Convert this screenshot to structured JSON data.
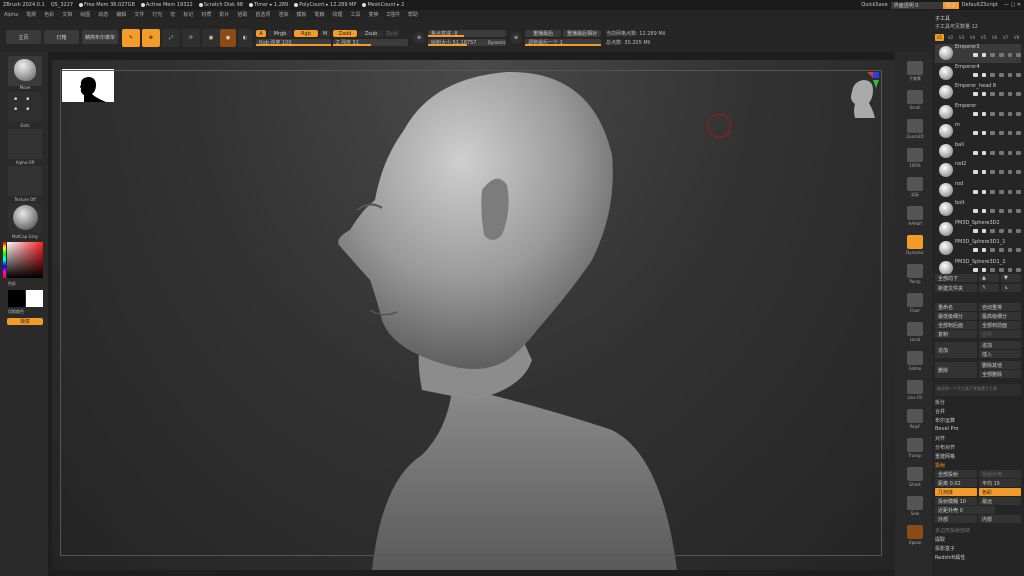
{
  "titlebar": {
    "app": "ZBrush 2024.0.1",
    "id": "QS_3227",
    "free_mem": "Free Mem 36.027GB",
    "active_mem": "Active Mem 19322",
    "scratch": "Scratch Disk 98",
    "timer": "Timer ▸ 1.289",
    "polycount": "PolyCount ▸ 12.289 MP",
    "meshcount": "MeshCount ▸ 2",
    "quicksave": "QuickSave",
    "transparency": "界面透明 0",
    "menu_btn": "菜单",
    "script": "DefaultZScript"
  },
  "menu": [
    "Alpha",
    "笔刷",
    "色彩",
    "文档",
    "绘图",
    "动态",
    "编辑",
    "文件",
    "灯光",
    "宏",
    "标记",
    "材质",
    "影片",
    "拾取",
    "首选项",
    "渲染",
    "模板",
    "笔触",
    "纹理",
    "工具",
    "变换",
    "Z插件",
    "帮助"
  ],
  "toolbar": {
    "home": "主页",
    "light": "灯箱",
    "quick": "精简布尔菜单",
    "draw": "绘制",
    "move": "移动",
    "scale": "缩放",
    "rotate": "旋转",
    "edit": "编辑",
    "a": "A",
    "mrgb": "Mrgb",
    "rgb": "Rgb",
    "m": "M",
    "zadd": "Zadd",
    "zsub": "Zsub",
    "zcut": "Zcut",
    "rgb_intensity": "Rgb 强度 100",
    "z_intensity": "Z 强度 51",
    "focal": "焦点衰减 -8",
    "draw_size": "绘制大小 51.18757",
    "dynamic": "Dynamic",
    "replay_last": "重播最后",
    "replay_rel": "重播最后相对",
    "replay_prev": "调整最后一个 1",
    "points": "当前网格点数: 12.289 Mil",
    "total": "总点数: 30.205 Mil"
  },
  "left": {
    "brush": "Move",
    "stroke": "Dots",
    "alpha": "Alpha Off",
    "texture": "Texture Off",
    "material": "MatCap Gray",
    "color_label": "色彩",
    "swap": "切换颜色",
    "gradient": "渐变"
  },
  "right_shelf": [
    "子像素",
    "Scroll",
    "Zoom2D",
    "100%",
    "实际",
    "AAHalf",
    "Dynamic",
    "Persp",
    "Floor",
    "Local",
    "Gizmo",
    "Line Fill",
    "PolyF",
    "Transp",
    "Ghost",
    "Solo",
    "Xpose"
  ],
  "panel": {
    "title": "子工具",
    "subtitle": "子工具可见数量 12",
    "vis": [
      "V1",
      "V2",
      "V3",
      "V4",
      "V5",
      "V6",
      "V7",
      "V8"
    ],
    "subtools": [
      "Emperor3",
      "Emperor4",
      "Emperor_head 8",
      "Emperor",
      "m",
      "ball",
      "rod2",
      "rod",
      "bolt",
      "PM3D_Sphere3D2",
      "PM3D_Sphere3D1_1",
      "PM3D_Sphere3D1_2"
    ],
    "all_low": "全部向下",
    "new_folder": "新建文件夹",
    "rename": "重命名",
    "auto_reorder": "自动重排",
    "all_low2": "最低级细分",
    "all_high": "最高级细分",
    "copy": "复制",
    "all_to_top": "全部到后面",
    "all_to_bottom": "全部到前面",
    "merge": "合并",
    "append": "追加",
    "insert": "插入",
    "delete": "删除",
    "del_others": "删除其他",
    "del_all": "全部删除",
    "hint": "拖动到一个子工具下并放置子工具",
    "split": "拆分",
    "merge2": "合并",
    "boolean": "布尔运算",
    "bevel": "Bevel Pro",
    "align": "对齐",
    "distribute": "分布对齐",
    "remesh": "重建网格",
    "project": "投射",
    "project_all": "全部投射",
    "proj_shell": "投射外壳",
    "dist": "距离 0.02",
    "avg": "平均 15",
    "geometry": "几何体",
    "color": "色彩",
    "project_blur": "投射模糊 10",
    "proj_farthest": "最远",
    "farthest_val": "近距外壳 0",
    "outer": "外部",
    "inner": "内部",
    "poly_project": "多边形投射自动",
    "extract": "提取",
    "shadow_box": "投影盒子",
    "remesh2": "Redshift属性"
  }
}
